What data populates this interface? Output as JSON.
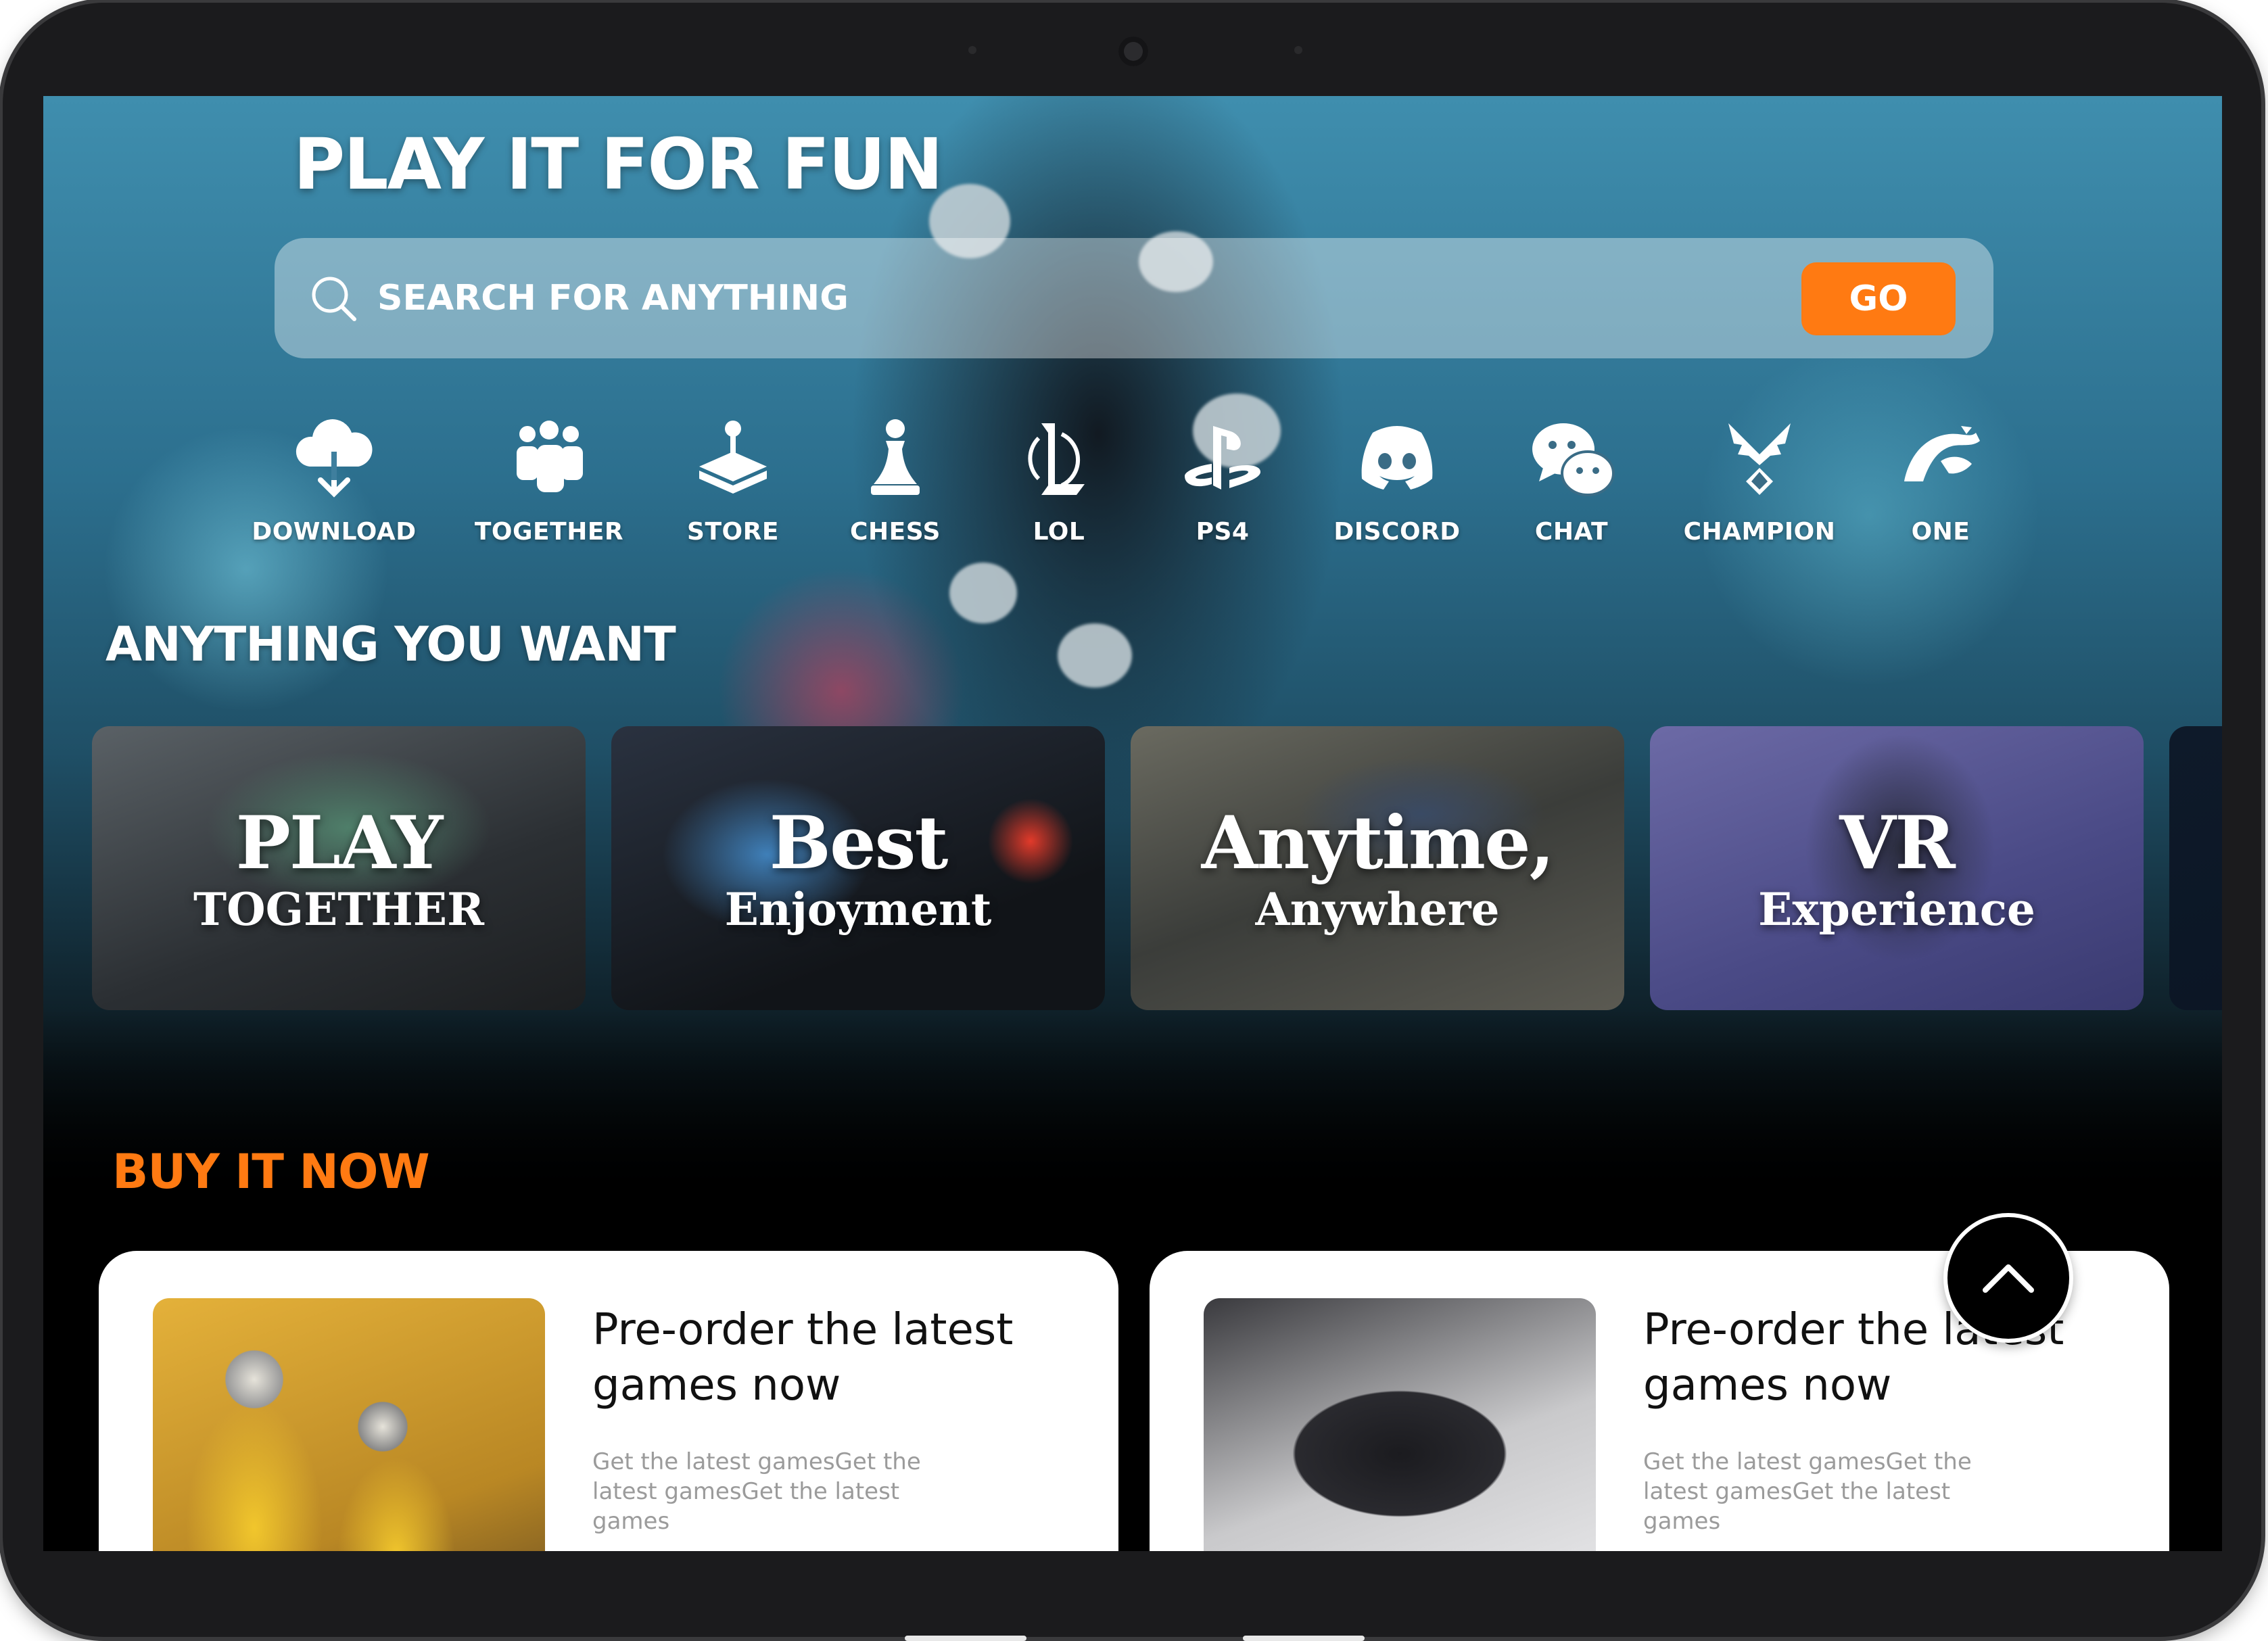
{
  "hero": {
    "title": "PLAY IT FOR FUN",
    "search": {
      "placeholder": "SEARCH FOR ANYTHING",
      "go_label": "GO"
    }
  },
  "categories": [
    {
      "label": "DOWNLOAD",
      "icon": "cloud-download-icon"
    },
    {
      "label": "TOGETHER",
      "icon": "group-icon"
    },
    {
      "label": "STORE",
      "icon": "joystick-icon"
    },
    {
      "label": "CHESS",
      "icon": "chess-pawn-icon"
    },
    {
      "label": "LOL",
      "icon": "lol-icon"
    },
    {
      "label": "PS4",
      "icon": "playstation-icon"
    },
    {
      "label": "DISCORD",
      "icon": "discord-icon"
    },
    {
      "label": "CHAT",
      "icon": "chat-icon"
    },
    {
      "label": "CHAMPION",
      "icon": "wings-icon"
    },
    {
      "label": "ONE",
      "icon": "one-logo-icon"
    }
  ],
  "anything": {
    "title": "ANYTHING YOU WANT",
    "cards": [
      {
        "big": "PLAY",
        "small": "TOGETHER"
      },
      {
        "big": "Best",
        "small": "Enjoyment"
      },
      {
        "big": "Anytime,",
        "small": "Anywhere"
      },
      {
        "big": "VR",
        "small": "Experience"
      }
    ]
  },
  "buy": {
    "title": "BUY IT NOW",
    "products": [
      {
        "title_line1": "Pre-order the latest",
        "title_line2": "games now",
        "desc": "Get the latest gamesGet the latest gamesGet the latest games"
      },
      {
        "title_line1": "Pre-order the latest",
        "title_line2": "games now",
        "desc": "Get the latest gamesGet the latest gamesGet the latest games"
      }
    ]
  },
  "colors": {
    "accent": "#ff7a12",
    "text_on_dark": "#ffffff"
  }
}
